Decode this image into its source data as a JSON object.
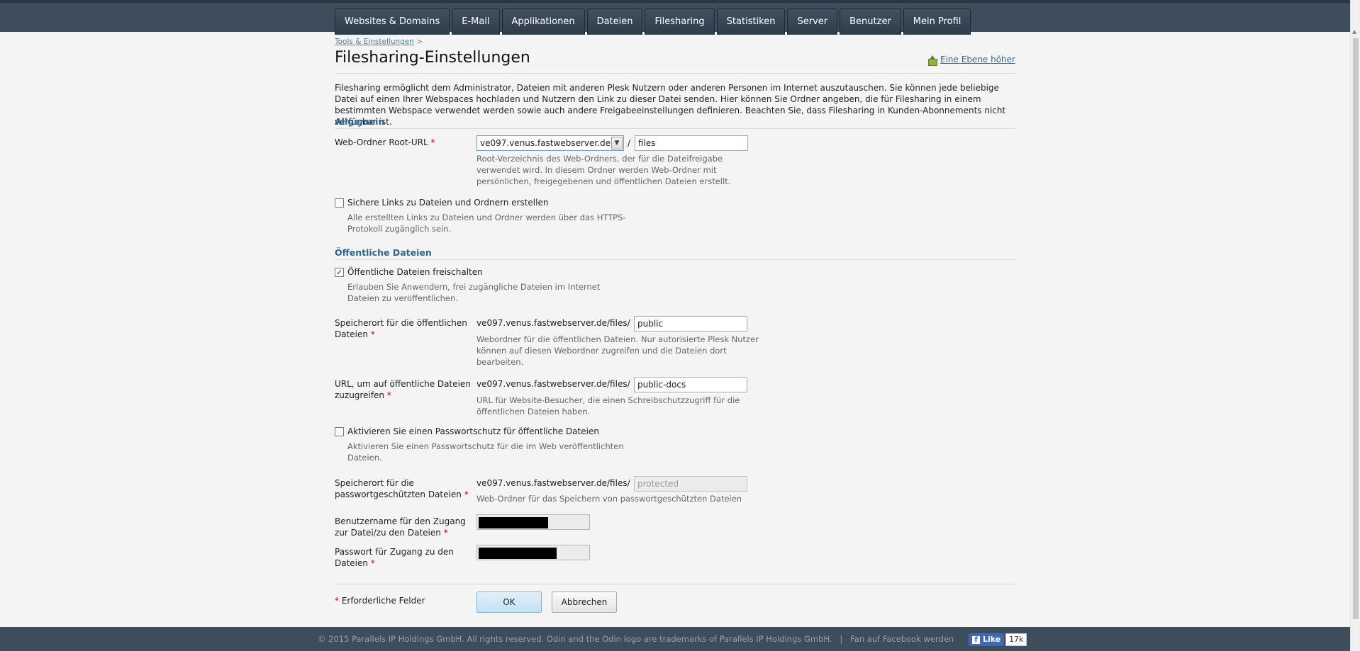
{
  "nav": {
    "tabs": [
      "Websites & Domains",
      "E-Mail",
      "Applikationen",
      "Dateien",
      "Filesharing",
      "Statistiken",
      "Server",
      "Benutzer",
      "Mein Profil"
    ]
  },
  "breadcrumb": {
    "link": "Tools & Einstellungen",
    "separator": ">"
  },
  "page_title": "Filesharing-Einstellungen",
  "up_link": "Eine Ebene höher",
  "intro_text": "Filesharing ermöglicht dem Administrator, Dateien mit anderen Plesk Nutzern oder anderen Personen im Internet auszutauschen. Sie können jede beliebige Datei auf einen Ihrer Webspaces hochladen und Nutzern den Link zu dieser Datei senden. Hier können Sie Ordner angeben, die für Filesharing in einem bestimmten Webspace verwendet werden sowie auch andere Freigabeeinstellungen definieren. Beachten Sie, dass Filesharing in Kunden-Abonnements nicht verfügbar ist.",
  "general": {
    "section_title": "Allgemein",
    "root_url_label": "Web-Ordner Root-URL",
    "root_url_domain": "ve097.venus.fastwebserver.de",
    "root_url_separator": "/",
    "root_url_folder": "files",
    "root_url_hint": "Root-Verzeichnis des Web-Ordners, der für die Dateifreigabe verwendet wird. In diesem Ordner werden Web-Ordner mit persönlichen, freigegebenen und öffentlichen Dateien erstellt.",
    "secure_links_label": "Sichere Links zu Dateien und Ordnern erstellen",
    "secure_links_checked": false,
    "secure_links_hint": "Alle erstellten Links zu Dateien und Ordner werden über das HTTPS-Protokoll zugänglich sein."
  },
  "public_files": {
    "section_title": "Öffentliche Dateien",
    "enable_label": "Öffentliche Dateien freischalten",
    "enable_checked": true,
    "enable_hint": "Erlauben Sie Anwendern, frei zugängliche Dateien im Internet Dateien zu veröffentlichen.",
    "location_label": "Speicherort für die öffentlichen Dateien",
    "path_prefix": "ve097.venus.fastwebserver.de/files/",
    "location_value": "public",
    "location_hint": "Webordner für die öffentlichen Dateien. Nur autorisierte Plesk Nutzer können auf diesen Webordner zugreifen und die Dateien dort bearbeiten.",
    "url_label": "URL, um auf öffentliche Dateien zuzugreifen",
    "url_value": "public-docs",
    "url_hint": "URL für Website-Besucher, die einen Schreibschutzzugriff für die öffentlichen Dateien haben.",
    "password_protect_label": "Aktivieren Sie einen Passwortschutz für öffentliche Dateien",
    "password_protect_checked": false,
    "password_protect_hint": "Aktivieren Sie einen Passwortschutz für die im Web veröffentlichten Dateien.",
    "protected_location_label": "Speicherort für die passwortgeschützten Dateien",
    "protected_location_placeholder": "protected",
    "protected_location_hint": "Web-Ordner für das Speichern von passwortgeschützten Dateien",
    "username_label": "Benutzername für den Zugang zur Datei/zu den Dateien",
    "password_label": "Passwort für Zugang zu den Dateien"
  },
  "form": {
    "required_asterisk": "*",
    "required_note": "Erforderliche Felder",
    "ok_label": "OK",
    "cancel_label": "Abbrechen"
  },
  "footer": {
    "copyright": "© 2015 Parallels IP Holdings GmbH. All rights reserved. Odin and the Odin logo are trademarks of Parallels IP Holdings GmbH.",
    "divider": "|",
    "facebook_text": "Fan auf Facebook werden",
    "like_label": "Like",
    "like_count": "17k"
  }
}
